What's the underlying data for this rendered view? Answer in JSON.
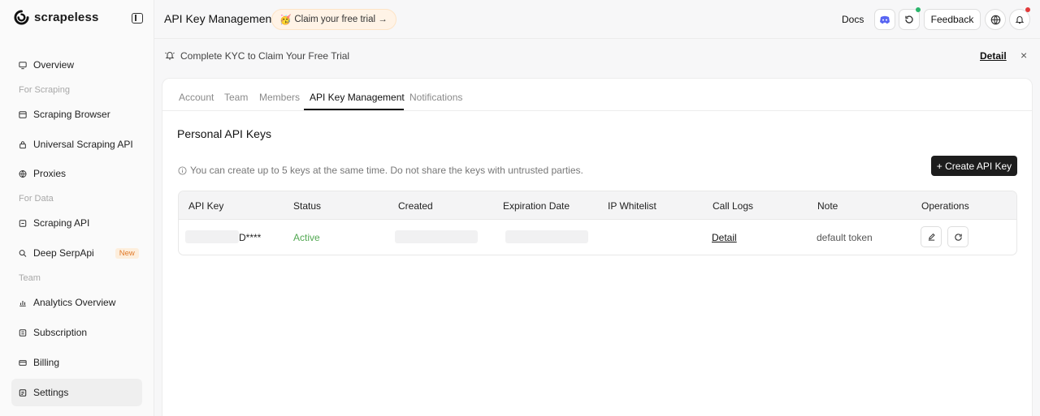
{
  "brand": {
    "name": "scrapeless"
  },
  "sidebar": {
    "items": [
      {
        "label": "Overview"
      },
      {
        "section": "For Scraping"
      },
      {
        "label": "Scraping Browser"
      },
      {
        "label": "Universal Scraping API"
      },
      {
        "label": "Proxies"
      },
      {
        "section": "For Data"
      },
      {
        "label": "Scraping API"
      },
      {
        "label": "Deep SerpApi",
        "badge": "New"
      },
      {
        "section": "Team"
      },
      {
        "label": "Analytics Overview"
      },
      {
        "label": "Subscription"
      },
      {
        "label": "Billing"
      },
      {
        "label": "Settings"
      }
    ]
  },
  "header": {
    "title": "API Key Management",
    "trial_emoji": "🥳",
    "trial_label": "Claim your free trial →",
    "docs_label": "Docs",
    "feedback_label": "Feedback"
  },
  "kyc": {
    "message": "Complete KYC to Claim Your Free Trial",
    "detail_label": "Detail",
    "close_label": "×"
  },
  "tabs": [
    {
      "label": "Account"
    },
    {
      "label": "Team"
    },
    {
      "label": "Members"
    },
    {
      "label": "API Key Management"
    },
    {
      "label": "Notifications"
    }
  ],
  "main": {
    "section_title": "Personal API Keys",
    "info_text": "You can create up to 5 keys at the same time. Do not share the keys with untrusted parties.",
    "create_button": "+ Create API Key"
  },
  "table": {
    "headers": [
      "API Key",
      "Status",
      "Created",
      "Expiration Date",
      "IP Whitelist",
      "Call Logs",
      "Note",
      "Operations"
    ],
    "rows": [
      {
        "api_key": "D****",
        "status": "Active",
        "created": "",
        "expiration": "",
        "ip_whitelist": "",
        "call_logs": "Detail",
        "note": "default token"
      }
    ]
  },
  "colors": {
    "accent": "#1d1d1d",
    "active_status": "#52a852",
    "new_badge": "#e07a2a",
    "notify_dot": "#e23a3a",
    "online_dot": "#2bb56b",
    "discord": "#5865f2"
  }
}
